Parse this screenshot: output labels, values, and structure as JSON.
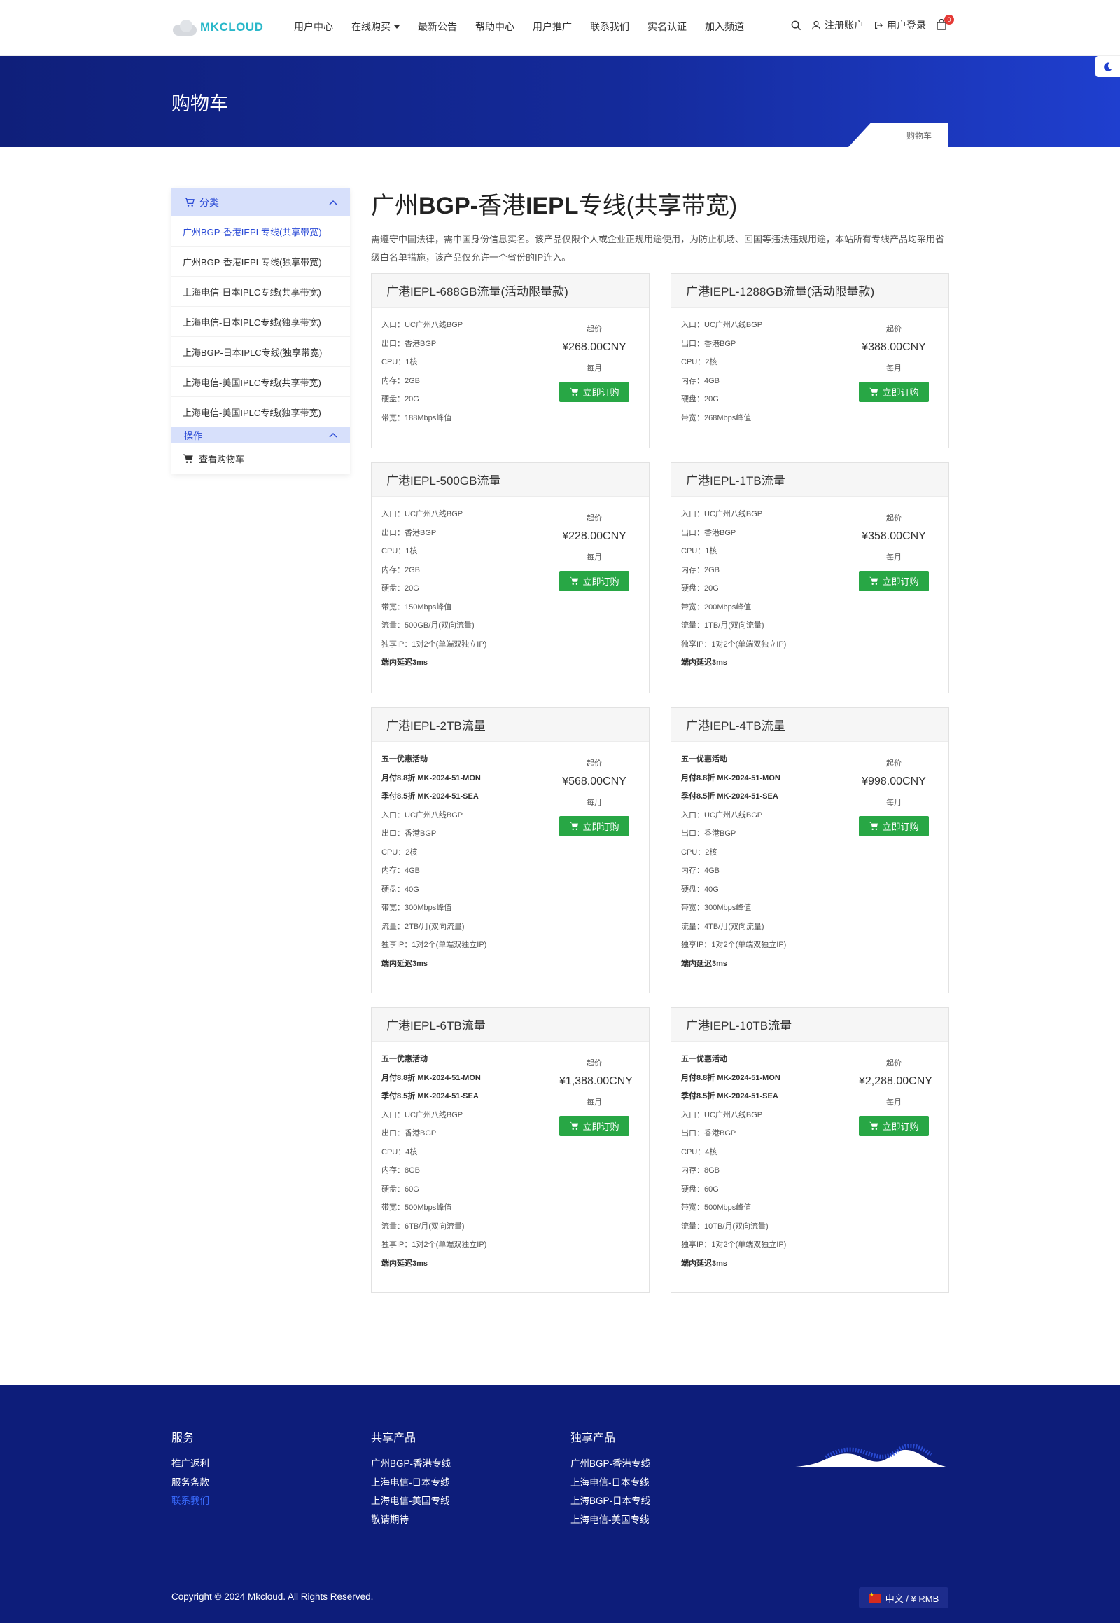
{
  "header": {
    "logo_text": "MKCLOUD",
    "menu": [
      "用户中心",
      "在线购买",
      "最新公告",
      "帮助中心",
      "用户推广",
      "联系我们",
      "实名认证",
      "加入频道"
    ],
    "register_label": "注册账户",
    "login_label": "用户登录",
    "cart_count": "0"
  },
  "banner": {
    "title": "购物车",
    "breadcrumb": "购物车"
  },
  "sidebar": {
    "category_title": "分类",
    "items": [
      "广州BGP-香港IEPL专线(共享带宽)",
      "广州BGP-香港IEPL专线(独享带宽)",
      "上海电信-日本IPLC专线(共享带宽)",
      "上海电信-日本IPLC专线(独享带宽)",
      "上海BGP-日本IPLC专线(独享带宽)",
      "上海电信-美国IPLC专线(共享带宽)",
      "上海电信-美国IPLC专线(独享带宽)"
    ],
    "actions_title": "操作",
    "view_cart": "查看购物车"
  },
  "main": {
    "title_a": "广州",
    "title_b": "BGP-",
    "title_c": "香港",
    "title_d": "IEPL",
    "title_e": "专线(共享带宽)",
    "description": "需遵守中国法律，需中国身份信息实名。该产品仅限个人或企业正规用途使用，为防止机场、回国等违法违规用途，本站所有专线产品均采用省级白名单措施，该产品仅允许一个省份的IP连入。"
  },
  "products": [
    {
      "name": "广港IEPL-688GB流量(活动限量款)",
      "features": [
        {
          "t": "入口：UC广州八线BGP",
          "b": false
        },
        {
          "t": "出口：香港BGP",
          "b": false
        },
        {
          "t": "CPU：1核",
          "b": false
        },
        {
          "t": "内存：2GB",
          "b": false
        },
        {
          "t": "硬盘：20G",
          "b": false
        },
        {
          "t": "带宽：188Mbps峰值",
          "b": false
        }
      ],
      "from": "起价",
      "price": "¥268.00CNY",
      "cycle": "每月",
      "button": "立即订购"
    },
    {
      "name": "广港IEPL-1288GB流量(活动限量款)",
      "features": [
        {
          "t": "入口：UC广州八线BGP",
          "b": false
        },
        {
          "t": "出口：香港BGP",
          "b": false
        },
        {
          "t": "CPU：2核",
          "b": false
        },
        {
          "t": "内存：4GB",
          "b": false
        },
        {
          "t": "硬盘：20G",
          "b": false
        },
        {
          "t": "带宽：268Mbps峰值",
          "b": false
        }
      ],
      "from": "起价",
      "price": "¥388.00CNY",
      "cycle": "每月",
      "button": "立即订购"
    },
    {
      "name": "广港IEPL-500GB流量",
      "features": [
        {
          "t": "入口：UC广州八线BGP",
          "b": false
        },
        {
          "t": "出口：香港BGP",
          "b": false
        },
        {
          "t": "CPU：1核",
          "b": false
        },
        {
          "t": "内存：2GB",
          "b": false
        },
        {
          "t": "硬盘：20G",
          "b": false
        },
        {
          "t": "带宽：150Mbps峰值",
          "b": false
        },
        {
          "t": "流量：500GB/月(双向流量)",
          "b": false
        },
        {
          "t": "独享IP：1对2个(单端双独立IP)",
          "b": false
        },
        {
          "t": "端内延迟3ms",
          "b": true
        }
      ],
      "from": "起价",
      "price": "¥228.00CNY",
      "cycle": "每月",
      "button": "立即订购"
    },
    {
      "name": "广港IEPL-1TB流量",
      "features": [
        {
          "t": "入口：UC广州八线BGP",
          "b": false
        },
        {
          "t": "出口：香港BGP",
          "b": false
        },
        {
          "t": "CPU：1核",
          "b": false
        },
        {
          "t": "内存：2GB",
          "b": false
        },
        {
          "t": "硬盘：20G",
          "b": false
        },
        {
          "t": "带宽：200Mbps峰值",
          "b": false
        },
        {
          "t": "流量：1TB/月(双向流量)",
          "b": false
        },
        {
          "t": "独享IP：1对2个(单端双独立IP)",
          "b": false
        },
        {
          "t": "端内延迟3ms",
          "b": true
        }
      ],
      "from": "起价",
      "price": "¥358.00CNY",
      "cycle": "每月",
      "button": "立即订购"
    },
    {
      "name": "广港IEPL-2TB流量",
      "features": [
        {
          "t": "五一优惠活动",
          "b": true
        },
        {
          "t": "月付8.8折 MK-2024-51-MON",
          "b": true
        },
        {
          "t": "季付8.5折 MK-2024-51-SEA",
          "b": true
        },
        {
          "t": "入口：UC广州八线BGP",
          "b": false
        },
        {
          "t": "出口：香港BGP",
          "b": false
        },
        {
          "t": "CPU：2核",
          "b": false
        },
        {
          "t": "内存：4GB",
          "b": false
        },
        {
          "t": "硬盘：40G",
          "b": false
        },
        {
          "t": "带宽：300Mbps峰值",
          "b": false
        },
        {
          "t": "流量：2TB/月(双向流量)",
          "b": false
        },
        {
          "t": "独享IP：1对2个(单端双独立IP)",
          "b": false
        },
        {
          "t": "端内延迟3ms",
          "b": true
        }
      ],
      "from": "起价",
      "price": "¥568.00CNY",
      "cycle": "每月",
      "button": "立即订购"
    },
    {
      "name": "广港IEPL-4TB流量",
      "features": [
        {
          "t": "五一优惠活动",
          "b": true
        },
        {
          "t": "月付8.8折 MK-2024-51-MON",
          "b": true
        },
        {
          "t": "季付8.5折 MK-2024-51-SEA",
          "b": true
        },
        {
          "t": "入口：UC广州八线BGP",
          "b": false
        },
        {
          "t": "出口：香港BGP",
          "b": false
        },
        {
          "t": "CPU：2核",
          "b": false
        },
        {
          "t": "内存：4GB",
          "b": false
        },
        {
          "t": "硬盘：40G",
          "b": false
        },
        {
          "t": "带宽：300Mbps峰值",
          "b": false
        },
        {
          "t": "流量：4TB/月(双向流量)",
          "b": false
        },
        {
          "t": "独享IP：1对2个(单端双独立IP)",
          "b": false
        },
        {
          "t": "端内延迟3ms",
          "b": true
        }
      ],
      "from": "起价",
      "price": "¥998.00CNY",
      "cycle": "每月",
      "button": "立即订购"
    },
    {
      "name": "广港IEPL-6TB流量",
      "features": [
        {
          "t": "五一优惠活动",
          "b": true
        },
        {
          "t": "月付8.8折 MK-2024-51-MON",
          "b": true
        },
        {
          "t": "季付8.5折 MK-2024-51-SEA",
          "b": true
        },
        {
          "t": "入口：UC广州八线BGP",
          "b": false
        },
        {
          "t": "出口：香港BGP",
          "b": false
        },
        {
          "t": "CPU：4核",
          "b": false
        },
        {
          "t": "内存：8GB",
          "b": false
        },
        {
          "t": "硬盘：60G",
          "b": false
        },
        {
          "t": "带宽：500Mbps峰值",
          "b": false
        },
        {
          "t": "流量：6TB/月(双向流量)",
          "b": false
        },
        {
          "t": "独享IP：1对2个(单端双独立IP)",
          "b": false
        },
        {
          "t": "端内延迟3ms",
          "b": true
        }
      ],
      "from": "起价",
      "price": "¥1,388.00CNY",
      "cycle": "每月",
      "button": "立即订购"
    },
    {
      "name": "广港IEPL-10TB流量",
      "features": [
        {
          "t": "五一优惠活动",
          "b": true
        },
        {
          "t": "月付8.8折 MK-2024-51-MON",
          "b": true
        },
        {
          "t": "季付8.5折 MK-2024-51-SEA",
          "b": true
        },
        {
          "t": "入口：UC广州八线BGP",
          "b": false
        },
        {
          "t": "出口：香港BGP",
          "b": false
        },
        {
          "t": "CPU：4核",
          "b": false
        },
        {
          "t": "内存：8GB",
          "b": false
        },
        {
          "t": "硬盘：60G",
          "b": false
        },
        {
          "t": "带宽：500Mbps峰值",
          "b": false
        },
        {
          "t": "流量：10TB/月(双向流量)",
          "b": false
        },
        {
          "t": "独享IP：1对2个(单端双独立IP)",
          "b": false
        },
        {
          "t": "端内延迟3ms",
          "b": true
        }
      ],
      "from": "起价",
      "price": "¥2,288.00CNY",
      "cycle": "每月",
      "button": "立即订购"
    }
  ],
  "footer": {
    "columns": [
      {
        "title": "服务",
        "links": [
          "推广返利",
          "服务条款",
          "联系我们"
        ]
      },
      {
        "title": "共享产品",
        "links": [
          "广州BGP-香港专线",
          "上海电信-日本专线",
          "上海电信-美国专线",
          "敬请期待"
        ]
      },
      {
        "title": "独享产品",
        "links": [
          "广州BGP-香港专线",
          "上海电信-日本专线",
          "上海BGP-日本专线",
          "上海电信-美国专线"
        ]
      }
    ],
    "copyright": "Copyright © 2024 Mkcloud. All Rights Reserved.",
    "language": "中文 / ¥ RMB"
  },
  "colors": {
    "brand_blue": "#2b4bd6",
    "banner_dark": "#0f1f7a",
    "order_green": "#28a745",
    "footer_bg": "#0d1d7a"
  }
}
